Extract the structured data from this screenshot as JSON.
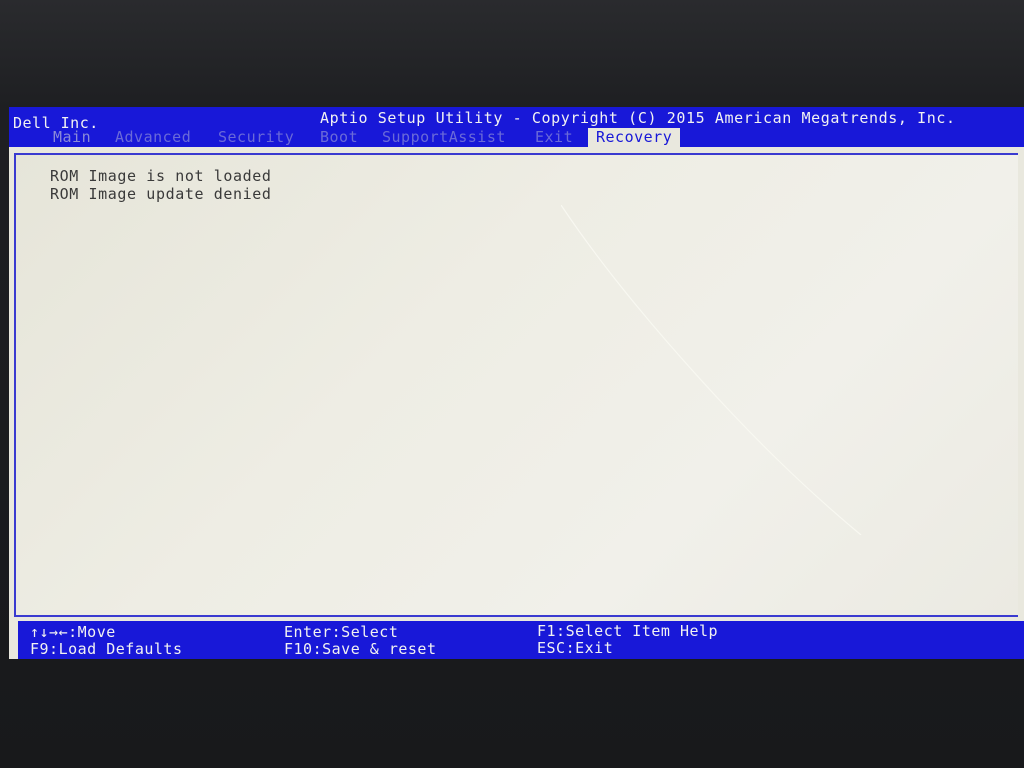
{
  "header": {
    "vendor": "Dell Inc.",
    "title": "Aptio Setup Utility - Copyright (C) 2015 American Megatrends, Inc."
  },
  "tabs": [
    {
      "label": "Main"
    },
    {
      "label": "Advanced"
    },
    {
      "label": "Security"
    },
    {
      "label": "Boot"
    },
    {
      "label": "SupportAssist"
    },
    {
      "label": "Exit"
    },
    {
      "label": "Recovery"
    }
  ],
  "active_tab": "Recovery",
  "messages": [
    "ROM Image is not loaded",
    "ROM Image update denied"
  ],
  "footer": {
    "move": "↑↓→←:Move",
    "select": "Enter:Select",
    "help": "F1:Select Item Help",
    "defaults": "F9:Load Defaults",
    "save": "F10:Save & reset",
    "exit": "ESC:Exit"
  },
  "colors": {
    "bios_blue": "#1818d8",
    "panel_bg": "#e9e8de",
    "text": "#3a3a3a"
  }
}
